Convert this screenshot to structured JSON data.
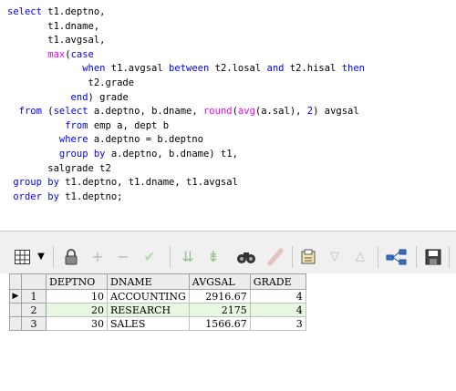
{
  "sql_lines": [
    "select t1.deptno,",
    "       t1.dname,",
    "       t1.avgsal,",
    "       max(case",
    "             when t1.avgsal between t2.losal and t2.hisal then",
    "              t2.grade",
    "           end) grade",
    "  from (select a.deptno, b.dname, round(avg(a.sal), 2) avgsal",
    "          from emp a, dept b",
    "         where a.deptno = b.deptno",
    "         group by a.deptno, b.dname) t1,",
    "       salgrade t2",
    " group by t1.deptno, t1.dname, t1.avgsal",
    " order by t1.deptno;"
  ],
  "toolbar": {
    "icons": [
      "grid-view-icon",
      "dropdown-arrow-icon",
      "lock-icon",
      "add-record-icon",
      "delete-record-icon",
      "post-changes-icon",
      "fetch-next-icon",
      "fetch-all-icon",
      "find-icon",
      "clear-icon",
      "export-icon",
      "filter-down-icon",
      "filter-up-icon",
      "link-icon",
      "save-icon"
    ]
  },
  "grid": {
    "columns": [
      "DEPTNO",
      "DNAME",
      "AVGSAL",
      "GRADE"
    ],
    "rows": [
      {
        "num": "1",
        "deptno": "10",
        "dname": "ACCOUNTING",
        "avgsal": "2916.67",
        "grade": "4"
      },
      {
        "num": "2",
        "deptno": "20",
        "dname": "RESEARCH",
        "avgsal": "2175",
        "grade": "4"
      },
      {
        "num": "3",
        "deptno": "30",
        "dname": "SALES",
        "avgsal": "1566.67",
        "grade": "3"
      }
    ],
    "current_row_marker": "▶"
  }
}
